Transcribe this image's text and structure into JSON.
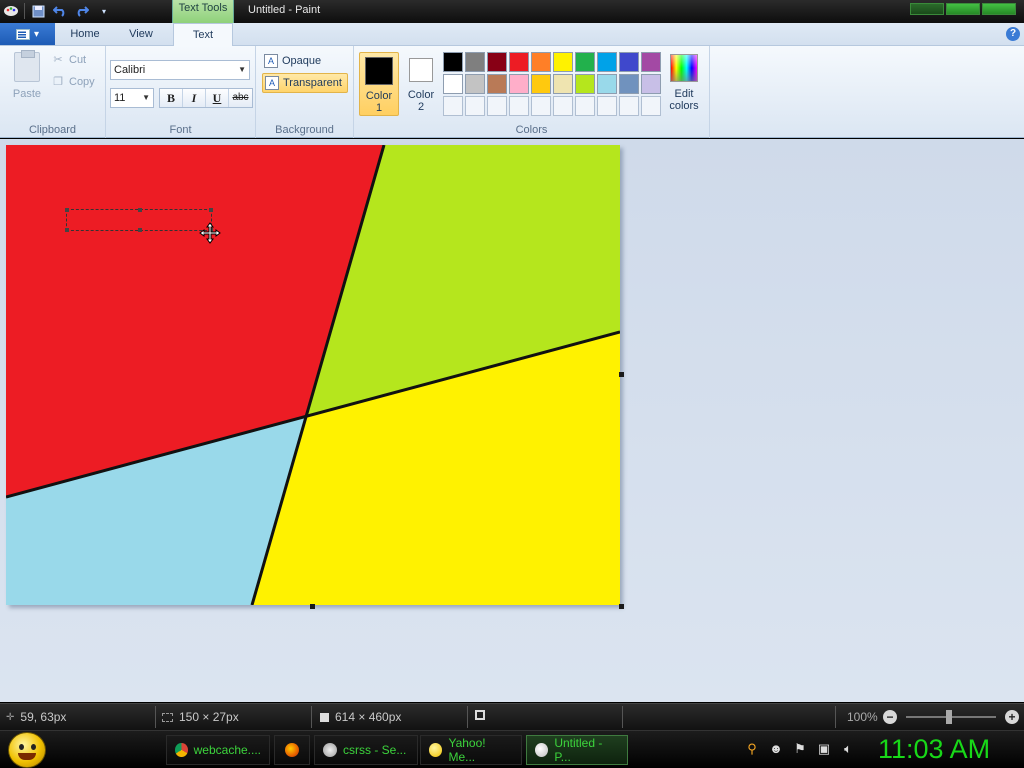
{
  "window": {
    "title": "Untitled - Paint",
    "contextual_tab": "Text Tools"
  },
  "quick_access": {
    "icons": [
      "paint-app-icon",
      "save-icon",
      "undo-icon",
      "redo-icon",
      "customize-dropdown-icon"
    ]
  },
  "tabs": {
    "home": "Home",
    "view": "View",
    "text": "Text"
  },
  "clipboard": {
    "label": "Clipboard",
    "paste": "Paste",
    "cut": "Cut",
    "copy": "Copy"
  },
  "font": {
    "label": "Font",
    "family": "Calibri",
    "size": "11",
    "bold": "B",
    "italic": "I",
    "underline": "U",
    "strikethrough": "abc"
  },
  "background": {
    "label": "Background",
    "opaque": "Opaque",
    "transparent": "Transparent",
    "selected": "Transparent"
  },
  "colors": {
    "label": "Colors",
    "color1_label_line1": "Color",
    "color1_label_line2": "1",
    "color1_value": "#000000",
    "color2_label_line1": "Color",
    "color2_label_line2": "2",
    "color2_value": "#ffffff",
    "edit_line1": "Edit",
    "edit_line2": "colors",
    "palette_row1": [
      "#000000",
      "#7f7f7f",
      "#880015",
      "#ed1c24",
      "#ff7f27",
      "#fff200",
      "#22b14c",
      "#00a2e8",
      "#3f48cc",
      "#a349a4"
    ],
    "palette_row2": [
      "#ffffff",
      "#c3c3c3",
      "#b97a57",
      "#ffaec9",
      "#ffc90e",
      "#efe4b0",
      "#b5e61d",
      "#99d9ea",
      "#7092be",
      "#c8bfe7"
    ],
    "palette_row3_empty": 10
  },
  "canvas": {
    "regions": {
      "top_left": "#ed1c24",
      "top_right": "#b5e61d",
      "bottom_left": "#99d9ea",
      "bottom_right": "#fff200"
    }
  },
  "status": {
    "cursor_pos": "59, 63px",
    "selection_size": "150 × 27px",
    "image_size": "614 × 460px",
    "zoom": "100%"
  },
  "taskbar": {
    "tasks": [
      {
        "label": "webcache....",
        "icon": "chrome-icon"
      },
      {
        "label": "",
        "icon": "firefox-icon"
      },
      {
        "label": "csrss - Se...",
        "icon": "process-icon"
      },
      {
        "label": "Yahoo! Me...",
        "icon": "yahoo-messenger-icon"
      },
      {
        "label": "Untitled - P...",
        "icon": "paint-icon"
      }
    ],
    "tray_icons": [
      "search-icon",
      "messenger-tray-icon",
      "action-center-flag-icon",
      "network-icon",
      "volume-icon"
    ],
    "clock": "11:03 AM"
  }
}
